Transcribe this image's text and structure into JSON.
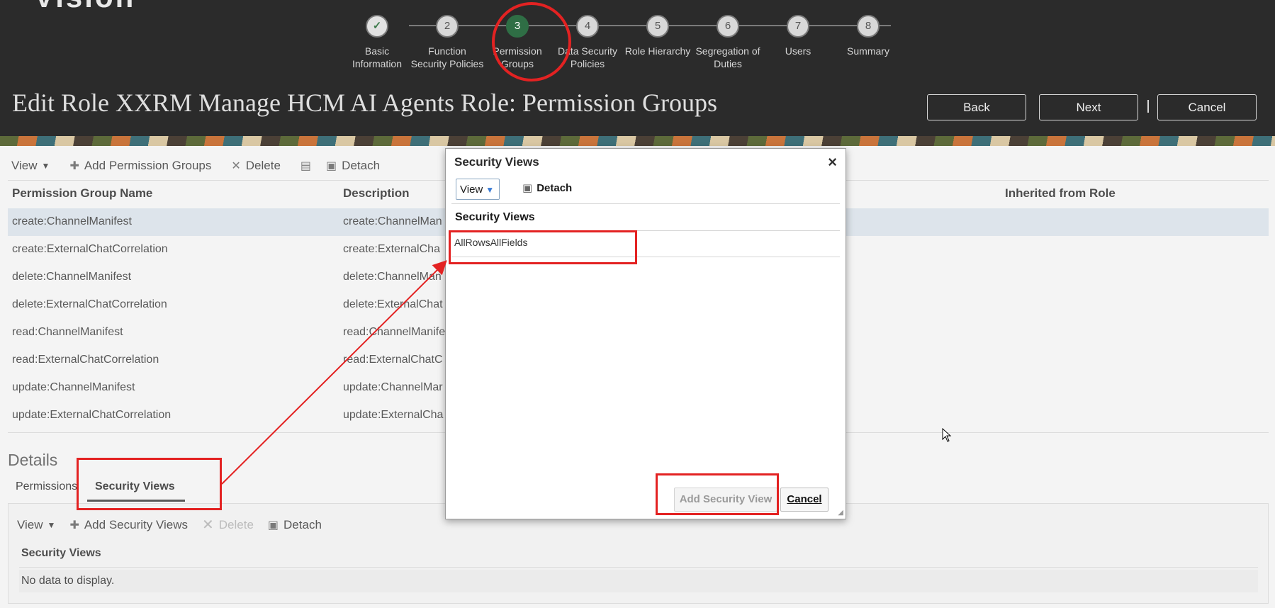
{
  "header": {
    "logo_fragment": "Vision",
    "title": "Edit Role XXRM Manage HCM AI Agents Role: Permission Groups",
    "buttons": {
      "back": "Back",
      "next": "Next",
      "cancel": "Cancel"
    },
    "steps": [
      {
        "number": "✓",
        "label_line1": "Basic",
        "label_line2": "Information",
        "state": "done"
      },
      {
        "number": "2",
        "label_line1": "Function",
        "label_line2": "Security Policies",
        "state": "pending"
      },
      {
        "number": "3",
        "label_line1": "Permission",
        "label_line2": "Groups",
        "state": "current"
      },
      {
        "number": "4",
        "label_line1": "Data Security",
        "label_line2": "Policies",
        "state": "pending"
      },
      {
        "number": "5",
        "label_line1": "Role Hierarchy",
        "label_line2": "",
        "state": "pending"
      },
      {
        "number": "6",
        "label_line1": "Segregation of",
        "label_line2": "Duties",
        "state": "pending"
      },
      {
        "number": "7",
        "label_line1": "Users",
        "label_line2": "",
        "state": "pending"
      },
      {
        "number": "8",
        "label_line1": "Summary",
        "label_line2": "",
        "state": "pending"
      }
    ]
  },
  "toolbar": {
    "view": "View",
    "add": "Add Permission Groups",
    "delete": "Delete",
    "detach": "Detach"
  },
  "table": {
    "columns": {
      "name": "Permission Group Name",
      "description": "Description",
      "inherited": "Inherited from Role"
    },
    "rows": [
      {
        "name": "create:ChannelManifest",
        "description": "create:ChannelMan"
      },
      {
        "name": "create:ExternalChatCorrelation",
        "description": "create:ExternalCha"
      },
      {
        "name": "delete:ChannelManifest",
        "description": "delete:ChannelMan"
      },
      {
        "name": "delete:ExternalChatCorrelation",
        "description": "delete:ExternalChat"
      },
      {
        "name": "read:ChannelManifest",
        "description": "read:ChannelManife"
      },
      {
        "name": "read:ExternalChatCorrelation",
        "description": "read:ExternalChatC"
      },
      {
        "name": "update:ChannelManifest",
        "description": "update:ChannelMar"
      },
      {
        "name": "update:ExternalChatCorrelation",
        "description": "update:ExternalCha"
      }
    ]
  },
  "details": {
    "title": "Details",
    "tabs": {
      "permissions": "Permissions",
      "security_views": "Security Views"
    },
    "toolbar": {
      "view": "View",
      "add": "Add Security Views",
      "delete": "Delete",
      "detach": "Detach"
    },
    "column": "Security Views",
    "empty": "No data to display."
  },
  "modal": {
    "title": "Security Views",
    "close": "×",
    "view": "View",
    "detach": "Detach",
    "column": "Security Views",
    "rows": [
      "AllRowsAllFields"
    ],
    "add_button": "Add Security View",
    "cancel_button": "Cancel"
  },
  "colors": {
    "annotation": "#e32222",
    "header_bg": "#2b2b2b",
    "current_step": "#2f6e45",
    "selected_row": "#d4dde6"
  }
}
